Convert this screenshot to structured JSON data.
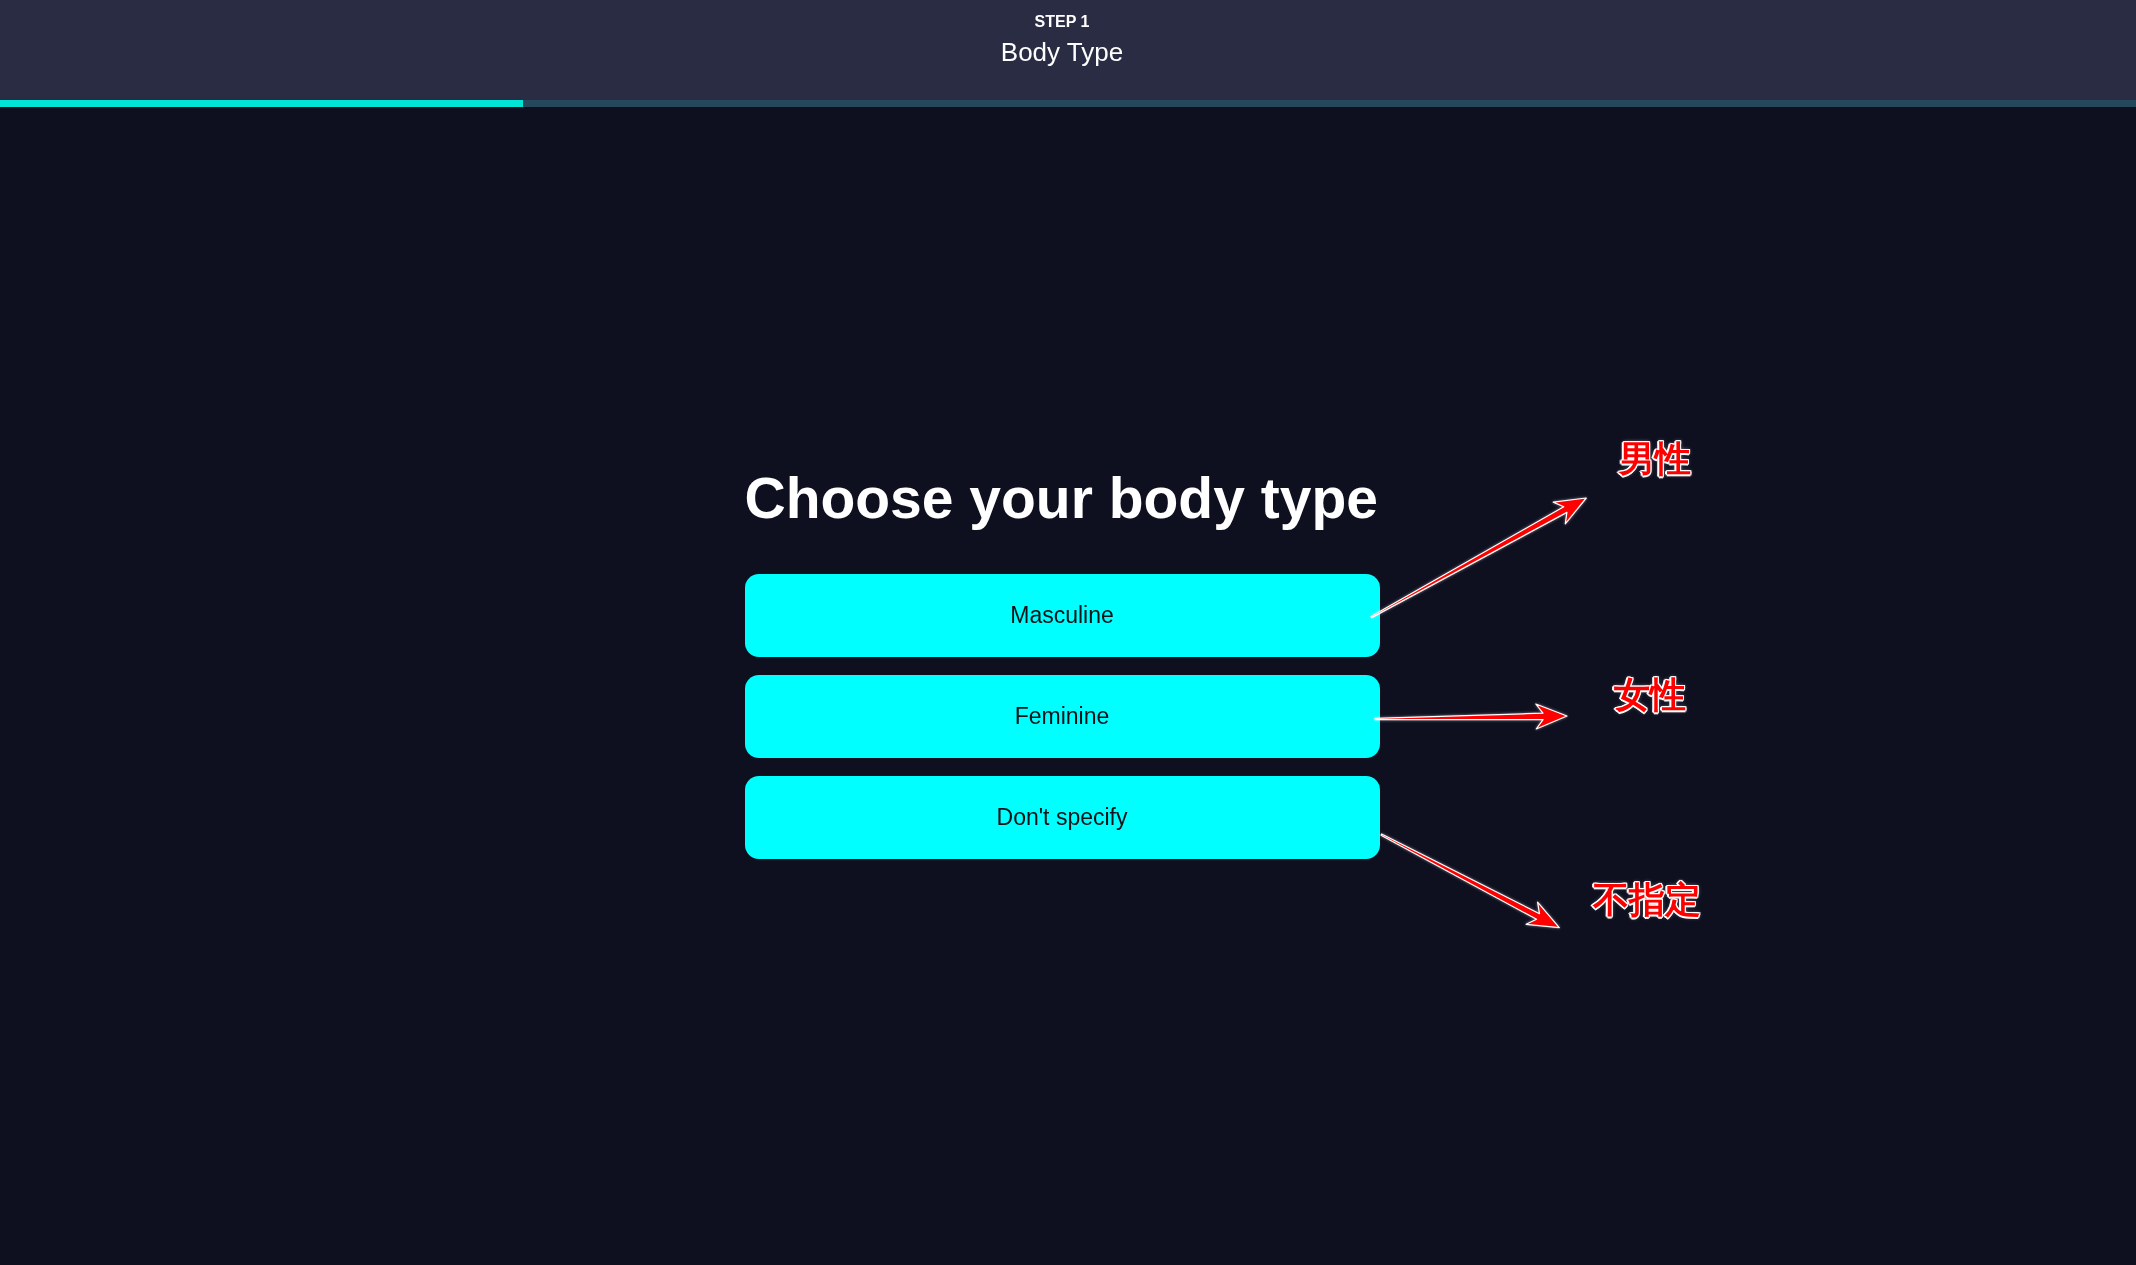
{
  "header": {
    "step_label": "STEP 1",
    "title": "Body Type"
  },
  "progress": {
    "level": 0.245
  },
  "heading": "Choose your body type",
  "options": [
    {
      "label": "Masculine",
      "selected": false,
      "annotation": "男性"
    },
    {
      "label": "Feminine",
      "selected": false,
      "annotation": "女性"
    },
    {
      "label": "Don't specify",
      "selected": false,
      "annotation": "不指定"
    }
  ]
}
